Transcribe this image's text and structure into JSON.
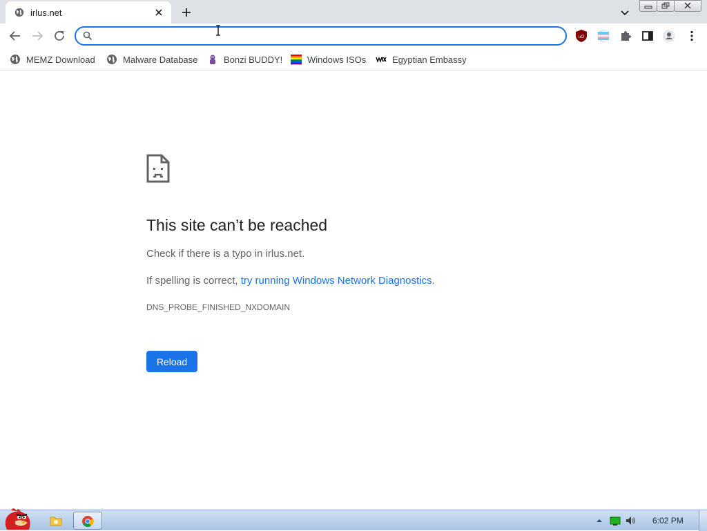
{
  "tab": {
    "title": "irlus.net",
    "favicon": "globe-icon"
  },
  "omnibox": {
    "value": "",
    "placeholder": ""
  },
  "bookmarks": [
    {
      "label": "MEMZ Download",
      "icon": "globe-icon"
    },
    {
      "label": "Malware Database",
      "icon": "globe-icon"
    },
    {
      "label": "Bonzi BUDDY!",
      "icon": "bonzi-icon"
    },
    {
      "label": "Windows ISOs",
      "icon": "rainbow-flag-icon"
    },
    {
      "label": "Egyptian Embassy",
      "icon": "wix-icon"
    }
  ],
  "error": {
    "title": "This site can’t be reached",
    "line1": "Check if there is a typo in irlus.net.",
    "line2_prefix": "If spelling is correct, ",
    "line2_link": "try running Windows Network Diagnostics",
    "line2_suffix": ".",
    "code": "DNS_PROBE_FINISHED_NXDOMAIN",
    "reload_label": "Reload"
  },
  "taskbar": {
    "clock": "6:02 PM"
  },
  "colors": {
    "accent": "#1a73e8",
    "tabstrip": "#dee1e6",
    "taskbar": "#b8d0ec"
  }
}
